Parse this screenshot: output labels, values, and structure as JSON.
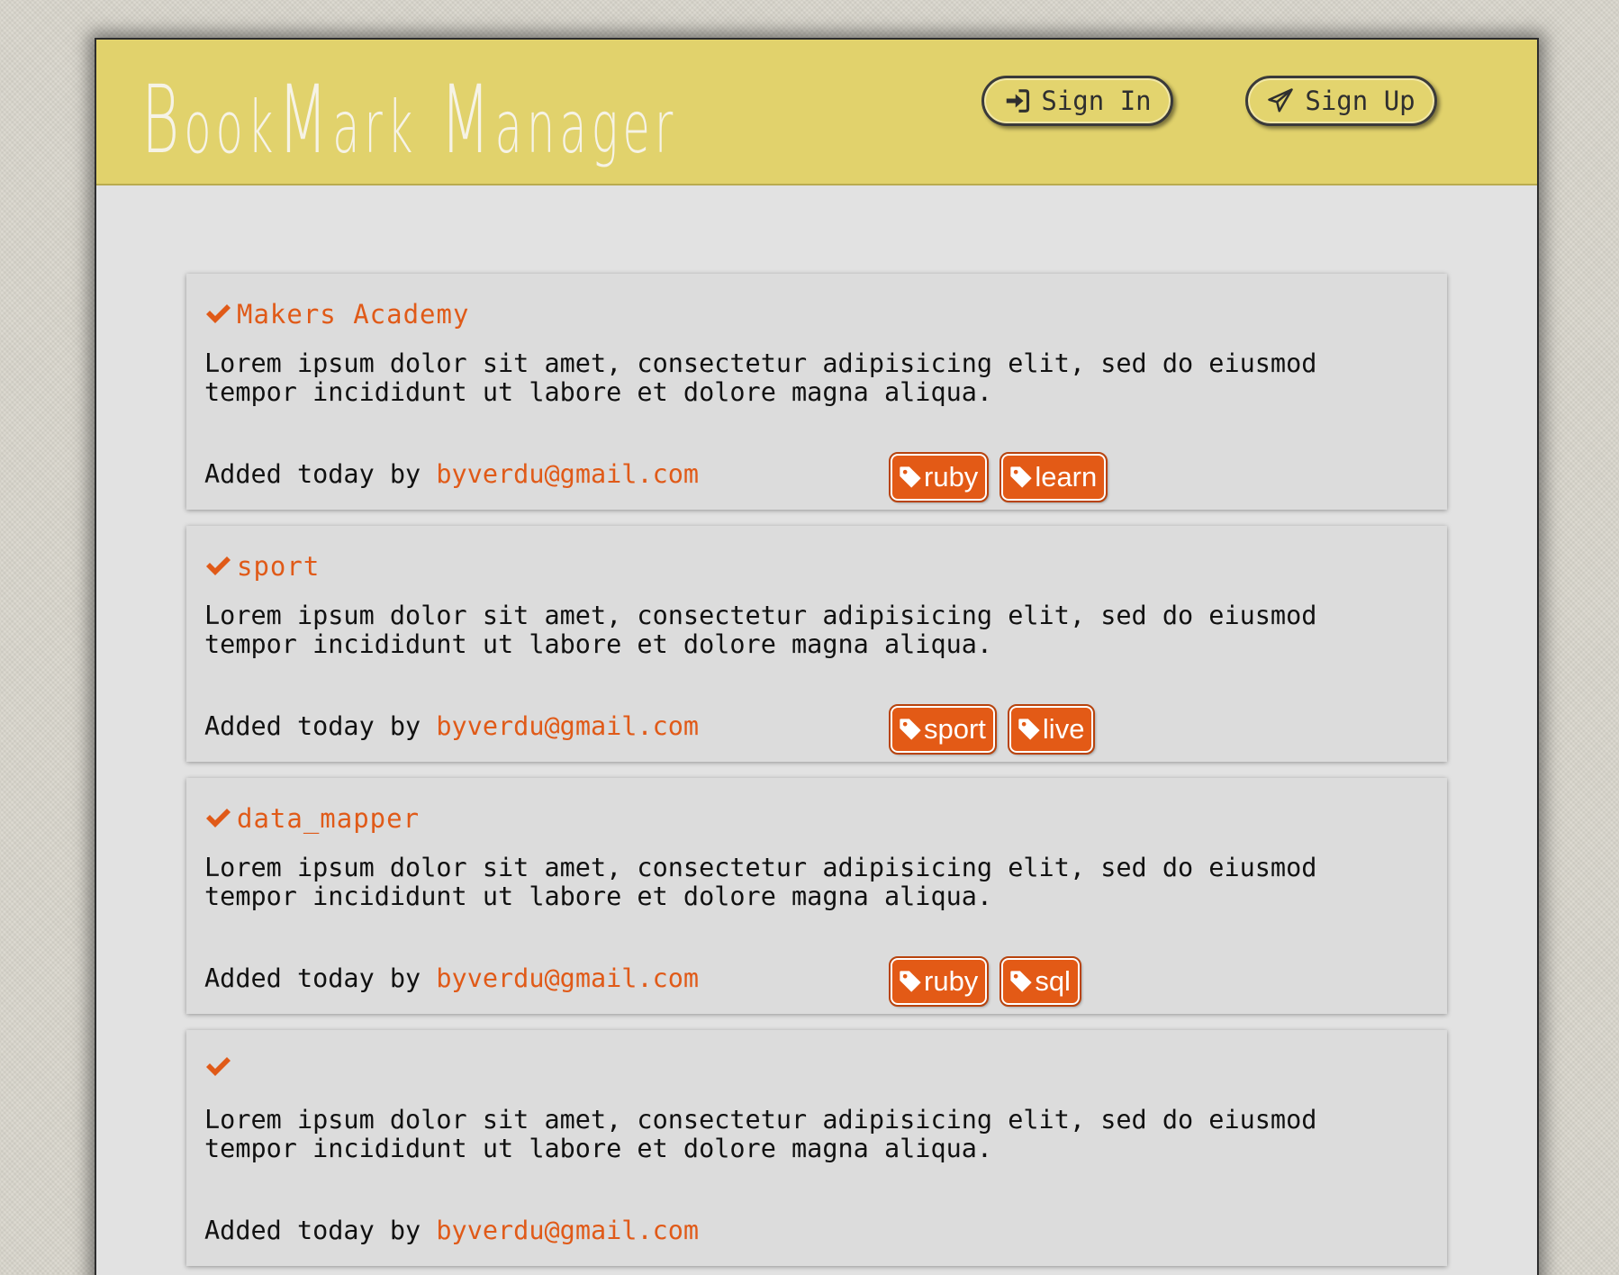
{
  "header": {
    "title_parts": [
      "B",
      "ook",
      "M",
      "ark",
      " ",
      "M",
      "anager"
    ],
    "signin_label": "Sign In",
    "signup_label": "Sign Up"
  },
  "colors": {
    "header_bg": "#e1d26c",
    "accent": "#e05a18",
    "tag_bg": "#e35a16",
    "content_bg": "#e2e2e2"
  },
  "bookmarks": [
    {
      "title": "Makers Academy",
      "description": "Lorem ipsum dolor sit amet, consectetur adipisicing elit, sed do eiusmod tempor incididunt ut labore et dolore magna aliqua.",
      "added_prefix": "Added today by ",
      "email": "byverdu@gmail.com",
      "tags": [
        "ruby",
        "learn"
      ]
    },
    {
      "title": "sport",
      "description": "Lorem ipsum dolor sit amet, consectetur adipisicing elit, sed do eiusmod tempor incididunt ut labore et dolore magna aliqua.",
      "added_prefix": "Added today by ",
      "email": "byverdu@gmail.com",
      "tags": [
        "sport",
        "live"
      ]
    },
    {
      "title": "data_mapper",
      "description": "Lorem ipsum dolor sit amet, consectetur adipisicing elit, sed do eiusmod tempor incididunt ut labore et dolore magna aliqua.",
      "added_prefix": "Added today by ",
      "email": "byverdu@gmail.com",
      "tags": [
        "ruby",
        "sql"
      ]
    },
    {
      "title": "",
      "description": "Lorem ipsum dolor sit amet, consectetur adipisicing elit, sed do eiusmod tempor incididunt ut labore et dolore magna aliqua.",
      "added_prefix": "Added today by ",
      "email": "byverdu@gmail.com",
      "tags": []
    }
  ]
}
